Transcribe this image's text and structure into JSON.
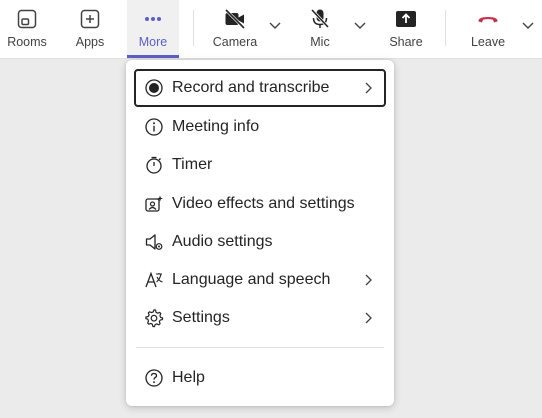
{
  "toolbar": {
    "rooms_label": "Rooms",
    "apps_label": "Apps",
    "more_label": "More",
    "camera_label": "Camera",
    "mic_label": "Mic",
    "share_label": "Share",
    "leave_label": "Leave"
  },
  "menu": {
    "items": [
      {
        "label": "Record and transcribe",
        "icon": "record-icon",
        "submenu": true
      },
      {
        "label": "Meeting info",
        "icon": "info-icon",
        "submenu": false
      },
      {
        "label": "Timer",
        "icon": "timer-icon",
        "submenu": false
      },
      {
        "label": "Video effects and settings",
        "icon": "video-effects-icon",
        "submenu": false
      },
      {
        "label": "Audio settings",
        "icon": "audio-settings-icon",
        "submenu": false
      },
      {
        "label": "Language and speech",
        "icon": "language-icon",
        "submenu": true
      },
      {
        "label": "Settings",
        "icon": "gear-icon",
        "submenu": true
      },
      {
        "label": "Help",
        "icon": "help-icon",
        "submenu": false
      }
    ]
  },
  "colors": {
    "accent": "#5b5fc7",
    "leave": "#c4314b",
    "text": "#242424"
  }
}
